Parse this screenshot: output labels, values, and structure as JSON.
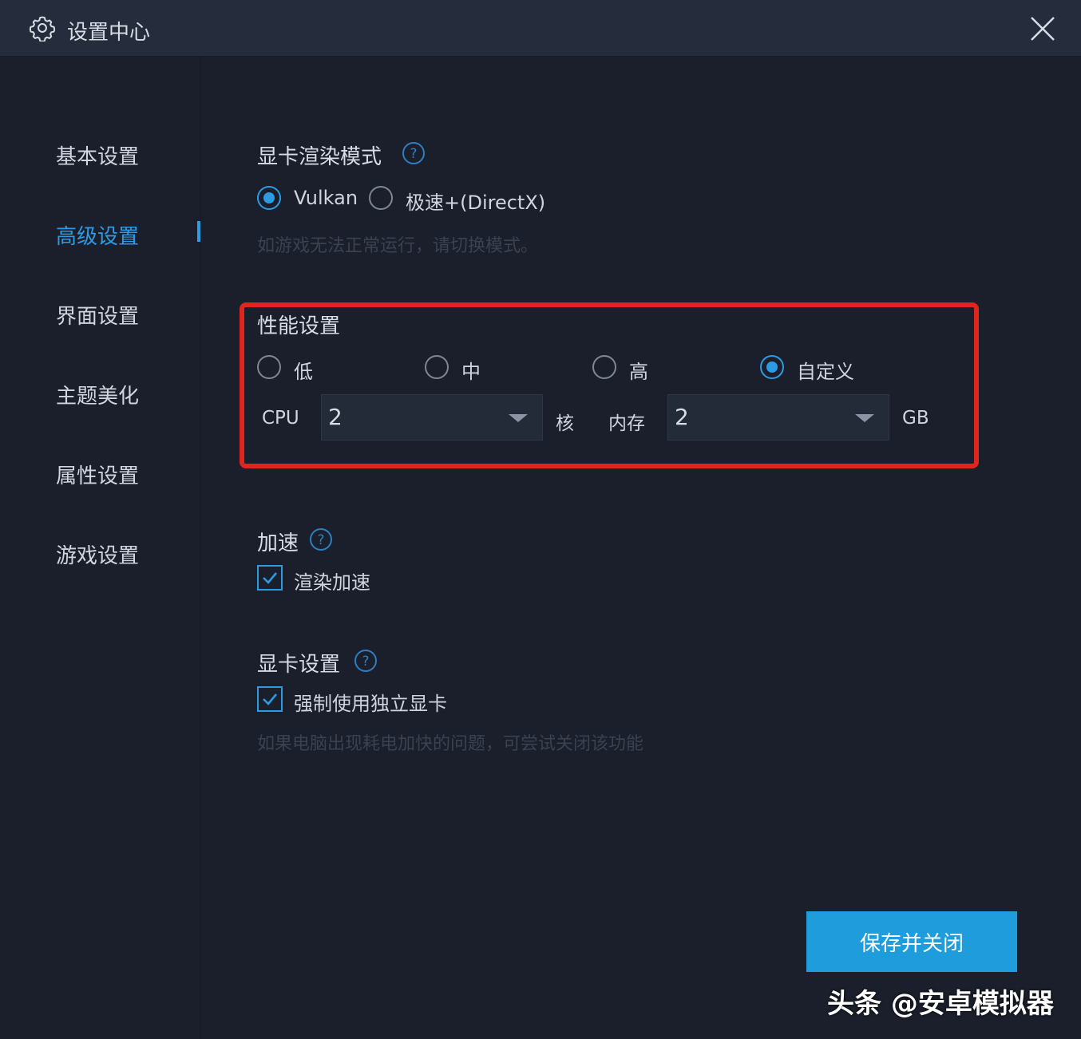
{
  "window": {
    "title": "设置中心"
  },
  "sidebar": {
    "items": [
      {
        "label": "基本设置",
        "active": false
      },
      {
        "label": "高级设置",
        "active": true
      },
      {
        "label": "界面设置",
        "active": false
      },
      {
        "label": "主题美化",
        "active": false
      },
      {
        "label": "属性设置",
        "active": false
      },
      {
        "label": "游戏设置",
        "active": false
      }
    ]
  },
  "render_mode": {
    "title": "显卡渲染模式",
    "options": [
      {
        "label": "Vulkan",
        "selected": true
      },
      {
        "label": "极速+(DirectX)",
        "selected": false
      }
    ],
    "hint": "如游戏无法正常运行，请切换模式。"
  },
  "performance": {
    "title": "性能设置",
    "options": [
      {
        "label": "低",
        "selected": false
      },
      {
        "label": "中",
        "selected": false
      },
      {
        "label": "高",
        "selected": false
      },
      {
        "label": "自定义",
        "selected": true
      }
    ],
    "cpu_label": "CPU",
    "cpu_value": "2",
    "cpu_unit": "核",
    "memory_label": "内存",
    "memory_value": "2",
    "memory_unit": "GB"
  },
  "acceleration": {
    "title": "加速",
    "checkbox_label": "渲染加速",
    "checked": true
  },
  "gpu": {
    "title": "显卡设置",
    "checkbox_label": "强制使用独立显卡",
    "checked": true,
    "hint": "如果电脑出现耗电加快的问题，可尝试关闭该功能"
  },
  "footer": {
    "save_label": "保存并关闭"
  },
  "watermark": "头条 @安卓模拟器",
  "colors": {
    "accent": "#2c9be3",
    "background": "#1a1f2b",
    "highlight": "#e0241e",
    "button": "#1e9cdb"
  }
}
